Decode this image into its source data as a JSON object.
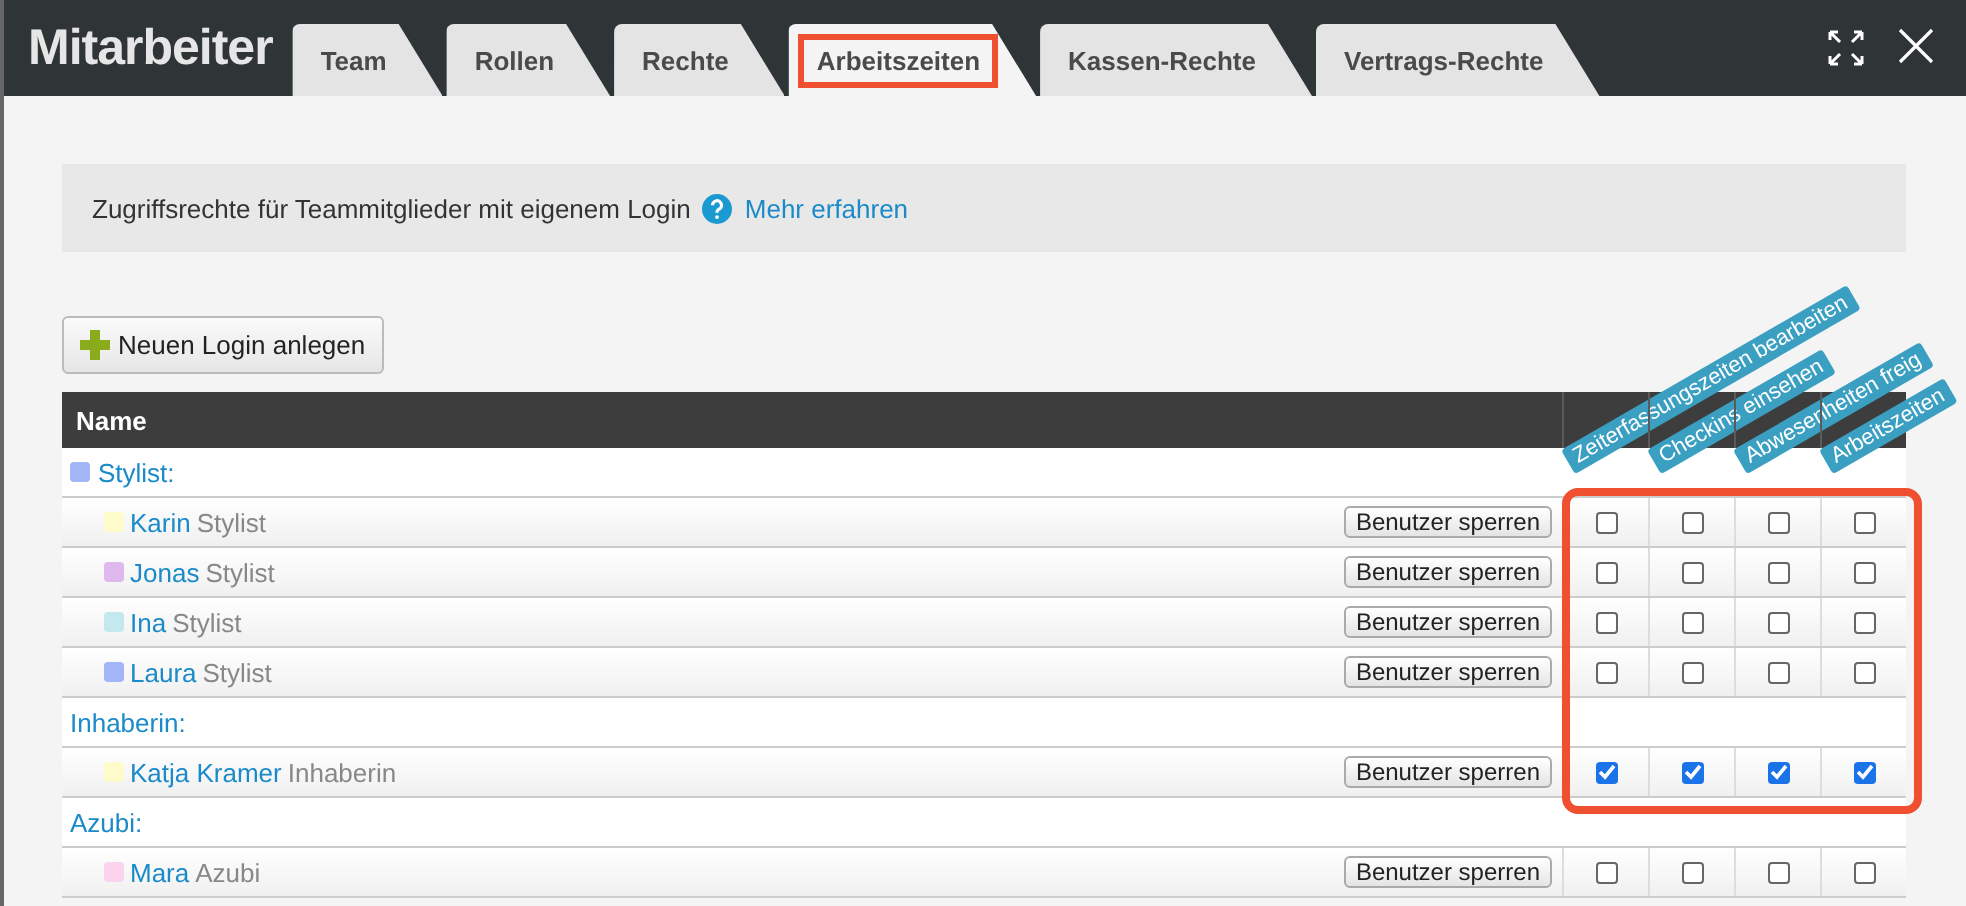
{
  "window": {
    "title": "Mitarbeiter"
  },
  "tabs": [
    {
      "label": "Team",
      "selected": false,
      "highlighted": false
    },
    {
      "label": "Rollen",
      "selected": false,
      "highlighted": false
    },
    {
      "label": "Rechte",
      "selected": false,
      "highlighted": false
    },
    {
      "label": "Arbeitszeiten",
      "selected": true,
      "highlighted": true
    },
    {
      "label": "Kassen-Rechte",
      "selected": false,
      "highlighted": false
    },
    {
      "label": "Vertrags-Rechte",
      "selected": false,
      "highlighted": false
    }
  ],
  "info": {
    "text": "Zugriffsrechte für Teammitglieder mit eigenem Login",
    "link": "Mehr erfahren"
  },
  "new_login_button": "Neuen Login anlegen",
  "table": {
    "name_column": "Name",
    "permission_columns": [
      "Zeiterfassungszeiten bearbeiten",
      "Checkins einsehen",
      "Abwesenheiten freig",
      "Arbeitszeiten"
    ],
    "groups": [
      {
        "label": "Stylist:",
        "color": "#a3b5f7",
        "highlighted": true,
        "members": [
          {
            "name": "Karin",
            "role": "Stylist",
            "color": "#fdfbcc",
            "button": "Benutzer sperren",
            "permissions": [
              false,
              false,
              false,
              false
            ]
          },
          {
            "name": "Jonas",
            "role": "Stylist",
            "color": "#dfb9ee",
            "button": "Benutzer sperren",
            "permissions": [
              false,
              false,
              false,
              false
            ]
          },
          {
            "name": "Ina",
            "role": "Stylist",
            "color": "#c3e9ef",
            "button": "Benutzer sperren",
            "permissions": [
              false,
              false,
              false,
              false
            ]
          },
          {
            "name": "Laura",
            "role": "Stylist",
            "color": "#a3b5f7",
            "button": "Benutzer sperren",
            "permissions": [
              false,
              false,
              false,
              false
            ]
          }
        ]
      },
      {
        "label": "Inhaberin:",
        "highlighted": true,
        "members": [
          {
            "name": "Katja Kramer",
            "role": "Inhaberin",
            "color": "#fdfbcc",
            "button": "Benutzer sperren",
            "permissions": [
              true,
              true,
              true,
              true
            ]
          }
        ]
      },
      {
        "label": "Azubi:",
        "highlighted": false,
        "members": [
          {
            "name": "Mara",
            "role": "Azubi",
            "color": "#fcd3ee",
            "button": "Benutzer sperren",
            "permissions": [
              false,
              false,
              false,
              false
            ]
          }
        ]
      }
    ]
  }
}
